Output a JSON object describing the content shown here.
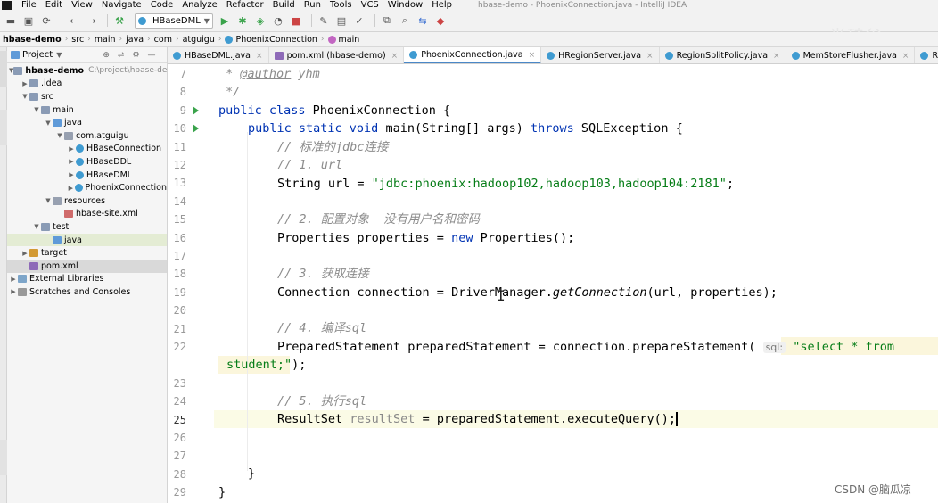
{
  "menu": {
    "items": [
      "File",
      "Edit",
      "View",
      "Navigate",
      "Code",
      "Analyze",
      "Refactor",
      "Build",
      "Run",
      "Tools",
      "VCS",
      "Window",
      "Help"
    ],
    "window_title": "hbase-demo - PhoenixConnection.java - IntelliJ IDEA"
  },
  "toolbar": {
    "run_config": "HBaseDML",
    "watermark": "尚硅谷"
  },
  "breadcrumbs": [
    "hbase-demo",
    "src",
    "main",
    "java",
    "com",
    "atguigu",
    "PhoenixConnection",
    "main"
  ],
  "project_panel": {
    "title": "Project",
    "tree": [
      {
        "label": "hbase-demo",
        "sub": "C:\\project\\hbase-dem",
        "icon": "folder-icon",
        "level": 0,
        "expanded": true
      },
      {
        "label": ".idea",
        "icon": "folder-icon",
        "level": 1,
        "expanded": false
      },
      {
        "label": "src",
        "icon": "folder-icon",
        "level": 1,
        "expanded": true
      },
      {
        "label": "main",
        "icon": "folder-icon",
        "level": 2,
        "expanded": true
      },
      {
        "label": "java",
        "icon": "source-folder-icon",
        "level": 3,
        "expanded": true
      },
      {
        "label": "com.atguigu",
        "icon": "package-icon",
        "level": 4,
        "expanded": true
      },
      {
        "label": "HBaseConnection",
        "icon": "java-class-icon",
        "level": 5,
        "expanded": false
      },
      {
        "label": "HBaseDDL",
        "icon": "java-class-icon",
        "level": 5,
        "expanded": false
      },
      {
        "label": "HBaseDML",
        "icon": "java-class-icon",
        "level": 5,
        "expanded": false
      },
      {
        "label": "PhoenixConnection",
        "icon": "java-class-icon",
        "level": 5,
        "expanded": false
      },
      {
        "label": "resources",
        "icon": "resources-folder-icon",
        "level": 3,
        "expanded": true
      },
      {
        "label": "hbase-site.xml",
        "icon": "xml-file-icon",
        "level": 4,
        "leaf": true
      },
      {
        "label": "test",
        "icon": "folder-icon",
        "level": 2,
        "expanded": true
      },
      {
        "label": "java",
        "icon": "test-folder-icon",
        "level": 3,
        "leaf": true,
        "highlight": "green"
      },
      {
        "label": "target",
        "icon": "target-folder-icon",
        "level": 1,
        "expanded": false
      },
      {
        "label": "pom.xml",
        "icon": "pom-file-icon",
        "level": 1,
        "leaf": true,
        "highlight": "gray"
      },
      {
        "label": "External Libraries",
        "icon": "library-icon",
        "level": 0,
        "expanded": false
      },
      {
        "label": "Scratches and Consoles",
        "icon": "scratch-icon",
        "level": 0,
        "expanded": false
      }
    ]
  },
  "tabs": [
    {
      "label": "HBaseDML.java",
      "icon": "java-class-icon",
      "active": false
    },
    {
      "label": "pom.xml (hbase-demo)",
      "icon": "pom-file-icon",
      "active": false
    },
    {
      "label": "PhoenixConnection.java",
      "icon": "java-class-icon",
      "active": true
    },
    {
      "label": "HRegionServer.java",
      "icon": "java-class-icon",
      "active": false
    },
    {
      "label": "RegionSplitPolicy.java",
      "icon": "java-class-icon",
      "active": false
    },
    {
      "label": "MemStoreFlusher.java",
      "icon": "java-class-icon",
      "active": false
    },
    {
      "label": "RegionServerAccoun",
      "icon": "java-class-icon",
      "active": false
    }
  ],
  "editor": {
    "line_numbers": [
      "7",
      "8",
      "9",
      "10",
      "11",
      "12",
      "13",
      "14",
      "15",
      "16",
      "17",
      "18",
      "19",
      "20",
      "21",
      "22",
      "",
      "23",
      "24",
      "25",
      "26",
      "27",
      "28",
      "29"
    ],
    "run_marker_lines": [
      "9",
      "10"
    ],
    "current_line": "25",
    "code": {
      "l7_doc": " * ",
      "l7_tag": "@author",
      "l7_name": " yhm",
      "l8": " */",
      "l9_kw": "public class",
      "l9_rest": " PhoenixConnection {",
      "l10_kw1": "public static void",
      "l10_mid": " main(String[] args) ",
      "l10_kw2": "throws",
      "l10_rest": " SQLException {",
      "l11_cm": "// 标准的jdbc连接",
      "l12_cm": "// 1. url",
      "l13_a": "String url = ",
      "l13_str": "\"jdbc:phoenix:hadoop102,hadoop103,hadoop104:2181\"",
      "l13_b": ";",
      "l15_cm": "// 2. 配置对象  没有用户名和密码",
      "l16_a": "Properties properties = ",
      "l16_kw": "new",
      "l16_b": " Properties();",
      "l18_cm": "// 3. 获取连接",
      "l19_a": "Connection connection = DriverManager.",
      "l19_m": "getConnection",
      "l19_b": "(url, properties);",
      "l21_cm": "// 4. 编译sql",
      "l22_a": "PreparedStatement preparedStatement = connection.prepareStatement(",
      "l22_hint": "sql:",
      "l22_str": "\"select * from",
      "l22w_str": "student;\"",
      "l22w_b": ");",
      "l24_cm": "// 5. 执行sql",
      "l25_a": "ResultSet ",
      "l25_unused": "resultSet",
      "l25_b": " = preparedStatement.executeQuery();",
      "l28": "}",
      "l29": "}"
    }
  },
  "footer": {
    "credit": "CSDN @脑瓜凉"
  }
}
